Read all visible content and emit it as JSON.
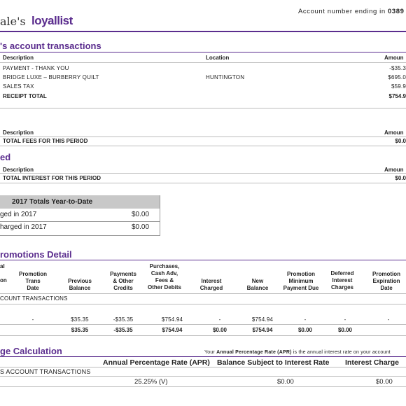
{
  "header": {
    "brand_left": "ale's",
    "brand_loyallist": "loyallist",
    "account_prefix": "Account number ending in",
    "account_suffix": "0389"
  },
  "account_transactions": {
    "title": "'s account transactions",
    "col_description": "Description",
    "col_location": "Location",
    "col_amount": "Amoun",
    "rows": [
      {
        "description": "PAYMENT - THANK YOU",
        "location": "",
        "amount": "-$35.3"
      },
      {
        "description": "BRIDGE LUXE – BURBERRY QUILT",
        "location": "HUNTINGTON",
        "amount": "$695.0"
      },
      {
        "description": "SALES TAX",
        "location": "",
        "amount": "$59.9"
      }
    ],
    "total_label": "RECEIPT TOTAL",
    "total_amount": "$754.9"
  },
  "fees": {
    "col_description": "Description",
    "col_amount": "Amoun",
    "total_label": "TOTAL FEES FOR THIS PERIOD",
    "total_amount": "$0.0"
  },
  "interest": {
    "title": "ed",
    "col_description": "Description",
    "col_amount": "Amoun",
    "total_label": "TOTAL INTEREST FOR THIS PERIOD",
    "total_amount": "$0.0"
  },
  "ytd": {
    "title": "2017 Totals Year-to-Date",
    "rows": [
      {
        "label": "ged in 2017",
        "amount": "$0.00"
      },
      {
        "label": "harged in 2017",
        "amount": "$0.00"
      }
    ]
  },
  "promotions": {
    "title": "romotions Detail",
    "headers": {
      "col0": [
        "al",
        "on"
      ],
      "col1": [
        "Promotion",
        "Trans",
        "Date"
      ],
      "col2": [
        "Previous",
        "Balance"
      ],
      "col3": [
        "Payments",
        "& Other",
        "Credits"
      ],
      "col4": [
        "Purchases,",
        "Cash Adv,",
        "Fees &",
        "Other Debits"
      ],
      "col5": [
        "Interest",
        "Charged"
      ],
      "col6": [
        "New",
        "Balance"
      ],
      "col7": [
        "Promotion",
        "Minimum",
        "Payment Due"
      ],
      "col8": [
        "Deferred",
        "Interest",
        "Charges"
      ],
      "col9": [
        "Promotion",
        "Expiration",
        "Date"
      ]
    },
    "group_label": "COUNT TRANSACTIONS",
    "row": [
      "-",
      "$35.35",
      "-$35.35",
      "$754.94",
      "-",
      "$754.94",
      "-",
      "-",
      "-"
    ],
    "total": [
      "$35.35",
      "-$35.35",
      "$754.94",
      "$0.00",
      "$754.94",
      "$0.00",
      "$0.00"
    ]
  },
  "charge_calc": {
    "title": "ge Calculation",
    "note_prefix": "Your",
    "note_bold": "Annual Percentage Rate (APR)",
    "note_suffix": "is the annual interest rate on your account",
    "col_apr": "Annual Percentage Rate (APR)",
    "col_balance": "Balance Subject to Interest Rate",
    "col_charge": "Interest Charge",
    "group_label": "S ACCOUNT TRANSACTIONS",
    "apr": "25.25% (V)",
    "balance": "$0.00",
    "charge": "$0.00"
  }
}
